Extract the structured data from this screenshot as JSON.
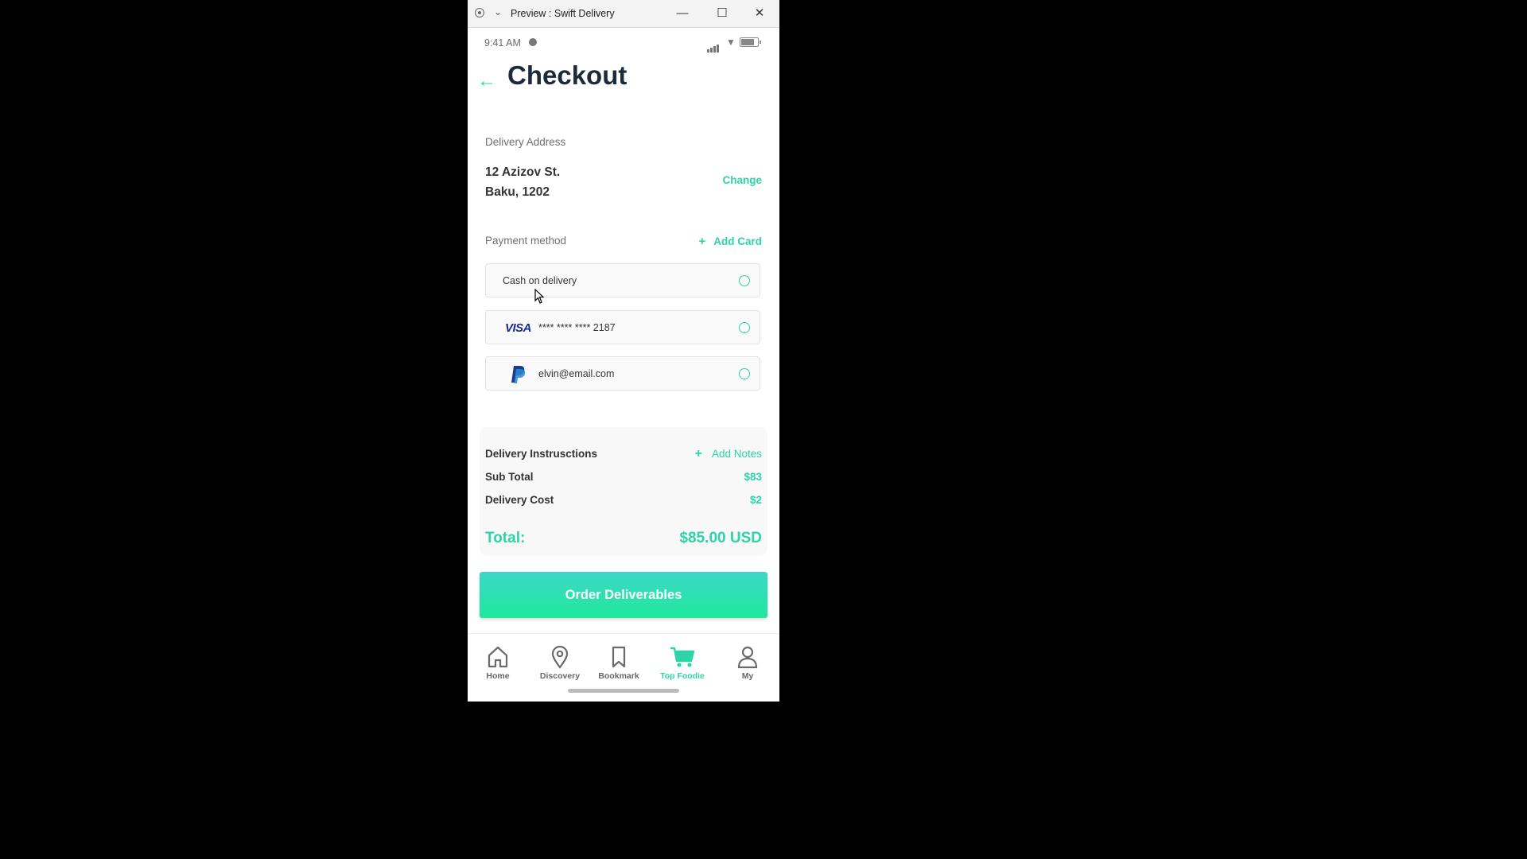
{
  "window": {
    "title": "Preview : Swift Delivery"
  },
  "status": {
    "time": "9:41 AM"
  },
  "header": {
    "title": "Checkout"
  },
  "delivery": {
    "label": "Delivery Address",
    "line1": "12 Azizov St.",
    "line2": "Baku, 1202",
    "change": "Change"
  },
  "payment": {
    "label": "Payment method",
    "add_card": "Add Card",
    "add_icon": "+",
    "options": [
      {
        "text": "Cash on delivery"
      },
      {
        "brand": "VISA",
        "text": "**** **** **** 2187"
      },
      {
        "text": "elvin@email.com"
      }
    ]
  },
  "summary": {
    "instructions": "Delivery Instrusctions",
    "add_notes": "Add Notes",
    "add_icon": "+",
    "subtotal_label": "Sub Total",
    "subtotal": "$83",
    "delivery_label": "Delivery Cost",
    "delivery": "$2",
    "total_label": "Total:",
    "total": "$85.00 USD"
  },
  "order_button": "Order Deliverables",
  "tabs": [
    {
      "label": "Home",
      "icon": "home-icon"
    },
    {
      "label": "Discovery",
      "icon": "location-pin-icon"
    },
    {
      "label": "Bookmark",
      "icon": "bookmark-icon"
    },
    {
      "label": "Top Foodie",
      "icon": "cart-icon",
      "active": true
    },
    {
      "label": "My",
      "icon": "user-icon"
    }
  ],
  "colors": {
    "accent": "#2dd4a7",
    "title": "#1d2a3a",
    "text": "#333333"
  }
}
